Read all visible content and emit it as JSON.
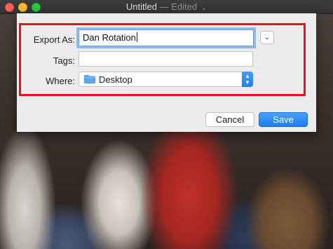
{
  "window": {
    "title": "Untitled",
    "edited_label": "— Edited",
    "title_chevron": "⌄"
  },
  "dialog": {
    "export_as_label": "Export As:",
    "export_as_value": "Dan Rotation",
    "tags_label": "Tags:",
    "tags_value": "",
    "where_label": "Where:",
    "where_value": "Desktop",
    "expand_glyph": "⌄",
    "stepper_up": "▲",
    "stepper_down": "▼",
    "cancel_label": "Cancel",
    "save_label": "Save"
  },
  "colors": {
    "accent_blue": "#1f7ff0",
    "highlight_red": "#e8141c",
    "folder_blue": "#5aa8f0"
  }
}
